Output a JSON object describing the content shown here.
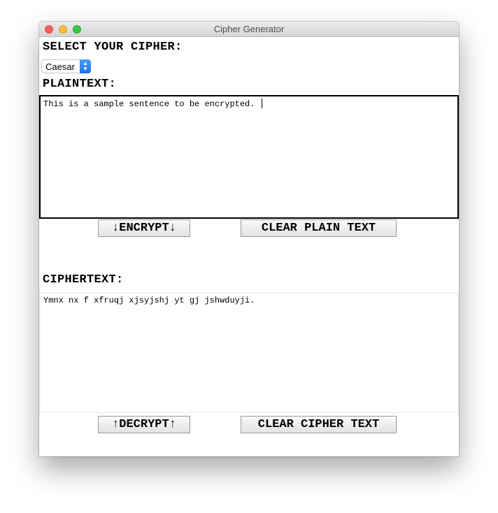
{
  "window": {
    "title": "Cipher Generator"
  },
  "cipher_select": {
    "heading": "SELECT YOUR CIPHER:",
    "selected": "Caesar"
  },
  "plaintext": {
    "heading": "PLAINTEXT:",
    "value": "This is a sample sentence to be encrypted. "
  },
  "plain_buttons": {
    "encrypt_label": "↓ENCRYPT↓",
    "clear_label": "CLEAR PLAIN TEXT"
  },
  "ciphertext": {
    "heading": "CIPHERTEXT:",
    "value": "Ymnx nx f xfruqj xjsyjshj yt gj jshwduyji."
  },
  "cipher_buttons": {
    "decrypt_label": "↑DECRYPT↑",
    "clear_label": "CLEAR CIPHER TEXT"
  }
}
